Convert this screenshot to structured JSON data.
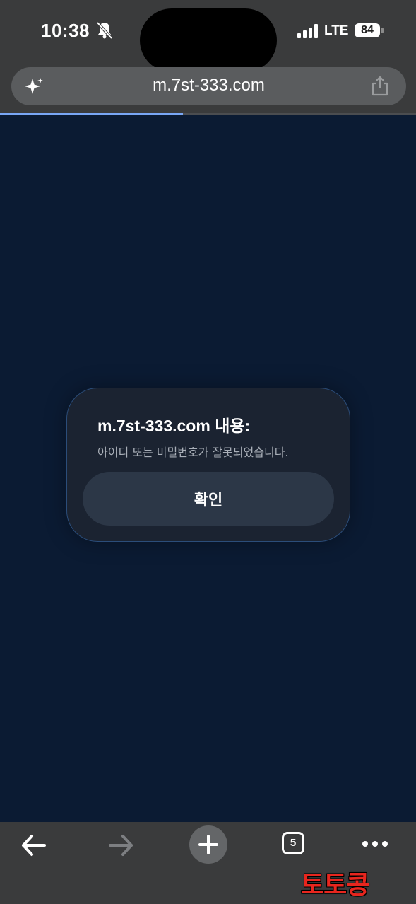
{
  "status_bar": {
    "time": "10:38",
    "network": "LTE",
    "battery": "84",
    "icons": [
      "bell-slash-icon",
      "signal-bars-icon"
    ]
  },
  "browser": {
    "url": "m.7st-333.com",
    "load_progress": 0.44,
    "tab_count": "5",
    "icons": [
      "sparkle-icon",
      "share-icon",
      "back-arrow-icon",
      "forward-arrow-icon",
      "plus-icon",
      "more-dots-icon"
    ]
  },
  "dialog": {
    "title": "m.7st-333.com 내용:",
    "message": "아이디 또는 비밀번호가 잘못되었습니다.",
    "ok_label": "확인"
  },
  "watermark": "토토콩",
  "colors": {
    "page_background": "#0b1b33",
    "chrome_background": "#3a3b3c",
    "progress_accent": "#7aa7f5",
    "dialog_background": "#1b2331",
    "watermark": "#e8261e"
  }
}
